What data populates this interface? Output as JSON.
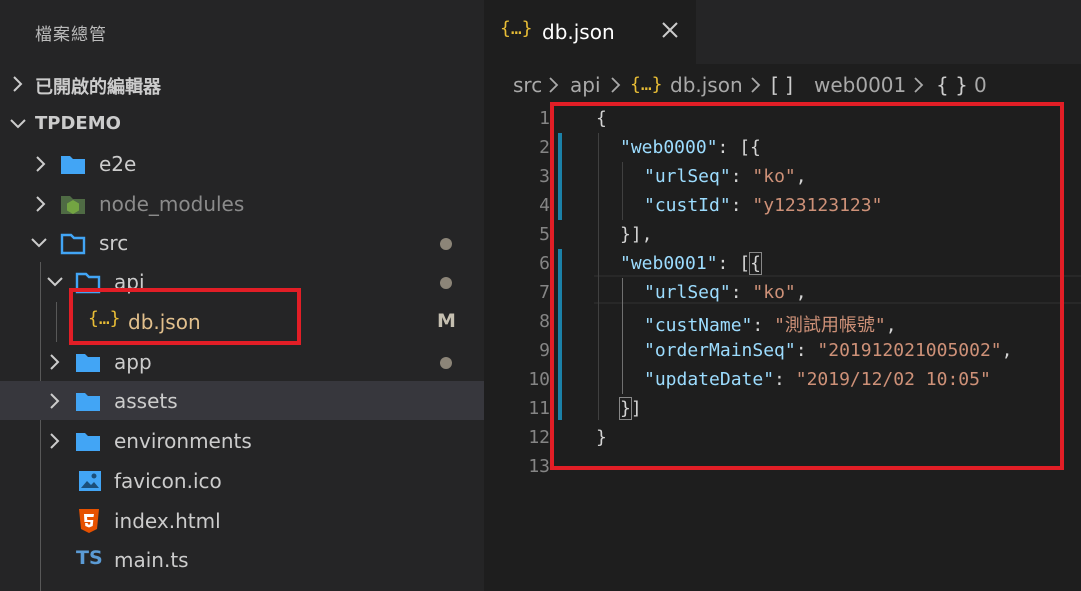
{
  "sidebar": {
    "title": "檔案總管",
    "open_editors_label": "已開啟的編輯器",
    "project_label": "TPDEMO",
    "tree": [
      {
        "label": "e2e"
      },
      {
        "label": "node_modules"
      },
      {
        "label": "src"
      },
      {
        "label": "api"
      },
      {
        "label": "db.json",
        "badge": "M"
      },
      {
        "label": "app"
      },
      {
        "label": "assets"
      },
      {
        "label": "environments"
      },
      {
        "label": "favicon.ico"
      },
      {
        "label": "index.html"
      },
      {
        "label": "main.ts"
      }
    ]
  },
  "tab": {
    "title": "db.json",
    "icon_text": "{…}"
  },
  "breadcrumb": {
    "items": [
      "src",
      "api",
      "db.json",
      "web0001",
      "0"
    ],
    "icons": [
      "",
      "",
      "{…}",
      "[ ]",
      "{ }"
    ]
  },
  "editor": {
    "line_numbers": [
      "1",
      "2",
      "3",
      "4",
      "5",
      "6",
      "7",
      "8",
      "9",
      "10",
      "11",
      "12",
      "13"
    ],
    "lines": [
      {
        "t1": "{"
      },
      {
        "k": "\"web0000\"",
        "t1": ": [{"
      },
      {
        "k": "\"urlSeq\"",
        "t1": ": ",
        "s": "\"ko\"",
        "t2": ","
      },
      {
        "k": "\"custId\"",
        "t1": ": ",
        "s": "\"y123123123\""
      },
      {
        "t1": "}],"
      },
      {
        "k": "\"web0001\"",
        "t1": ": [",
        "b": "{"
      },
      {
        "k": "\"urlSeq\"",
        "t1": ": ",
        "s": "\"ko\"",
        "t2": ","
      },
      {
        "k": "\"custName\"",
        "t1": ": ",
        "s": "\"測試用帳號\"",
        "t2": ","
      },
      {
        "k": "\"orderMainSeq\"",
        "t1": ": ",
        "s": "\"201912021005002\"",
        "t2": ","
      },
      {
        "k": "\"updateDate\"",
        "t1": ": ",
        "s": "\"2019/12/02 10:05\""
      },
      {
        "b": "}",
        "t2": "]"
      },
      {
        "t1": "}"
      },
      {}
    ]
  },
  "colors": {
    "highlight": "#e21e26",
    "folder": "#42a5f5",
    "json_icon": "#e8bd36",
    "key": "#9cdcfe",
    "string": "#ce9178"
  }
}
